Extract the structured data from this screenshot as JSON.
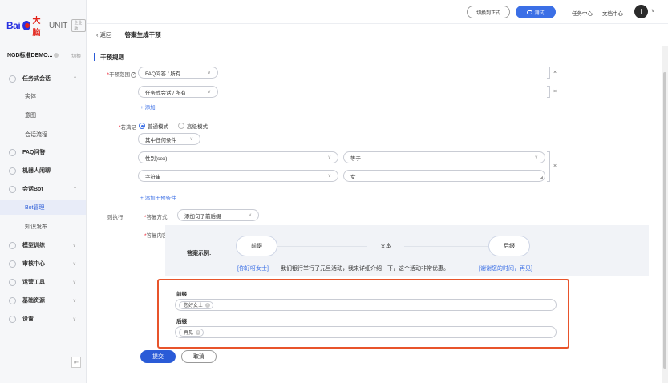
{
  "brand": {
    "logo_bai": "Bai",
    "logo_du": "大脑",
    "product": "UNIT",
    "edition": "企业版"
  },
  "app": {
    "name": "NGD标准DEMO...",
    "switch_label": "切换"
  },
  "sidebar": {
    "items": [
      {
        "label": "任务式会话",
        "expand": "^"
      },
      {
        "label": "实体"
      },
      {
        "label": "意图"
      },
      {
        "label": "会话流程"
      },
      {
        "label": "FAQ问答"
      },
      {
        "label": "机器人闲聊"
      },
      {
        "label": "会话Bot",
        "expand": "^"
      },
      {
        "label": "Bot管理"
      },
      {
        "label": "知识发布"
      },
      {
        "label": "模型训练",
        "expand": "∨"
      },
      {
        "label": "审核中心",
        "expand": "∨"
      },
      {
        "label": "运营工具",
        "expand": "∨"
      },
      {
        "label": "基础资源",
        "expand": "∨"
      },
      {
        "label": "设置",
        "expand": "∨"
      }
    ],
    "collapse_icon": "⇤"
  },
  "topbar": {
    "switch_formal": "切换到正式",
    "test_label": "测试",
    "task_center": "任务中心",
    "doc_center": "文档中心",
    "avatar_letter": "f"
  },
  "breadcrumb": {
    "back": "‹ 返回",
    "title": "答案生成干预"
  },
  "form": {
    "section_title": "干预规则",
    "scope_label": "干预范围",
    "scope_values": [
      "FAQ问答 / 所有",
      "任务式会话 / 所有"
    ],
    "add_label": "+ 添加",
    "condition_label": "若满足",
    "mode_normal": "普通模式",
    "mode_advanced": "高级模式",
    "match_option": "其中任何条件",
    "cond_field": "性别(sex)",
    "cond_operator": "等于",
    "cond_type": "字符串",
    "cond_value": "女",
    "add_condition": "+ 添加干预条件",
    "then_label": "则执行",
    "reply_method_label": "答复方式",
    "reply_method_value": "添加句子前后缀",
    "reply_content_label": "答复内容",
    "example_label": "答案示例:",
    "bubble_prefix": "前缀",
    "bubble_text": "文本",
    "bubble_suffix": "后缀",
    "example_prefix": "[你好呀女士]",
    "example_body": "我们银行举行了元旦活动，我来详细介绍一下，这个活动非常优惠。",
    "example_suffix": "[谢谢您的时间，再见]",
    "prefix_label": "前缀",
    "prefix_tag": "您好女士",
    "suffix_label": "后缀",
    "suffix_tag": "再见",
    "submit": "提交",
    "cancel": "取消"
  },
  "colors": {
    "primary": "#2a5bd7",
    "highlight": "#e8542b",
    "link": "#3b6fe6"
  }
}
